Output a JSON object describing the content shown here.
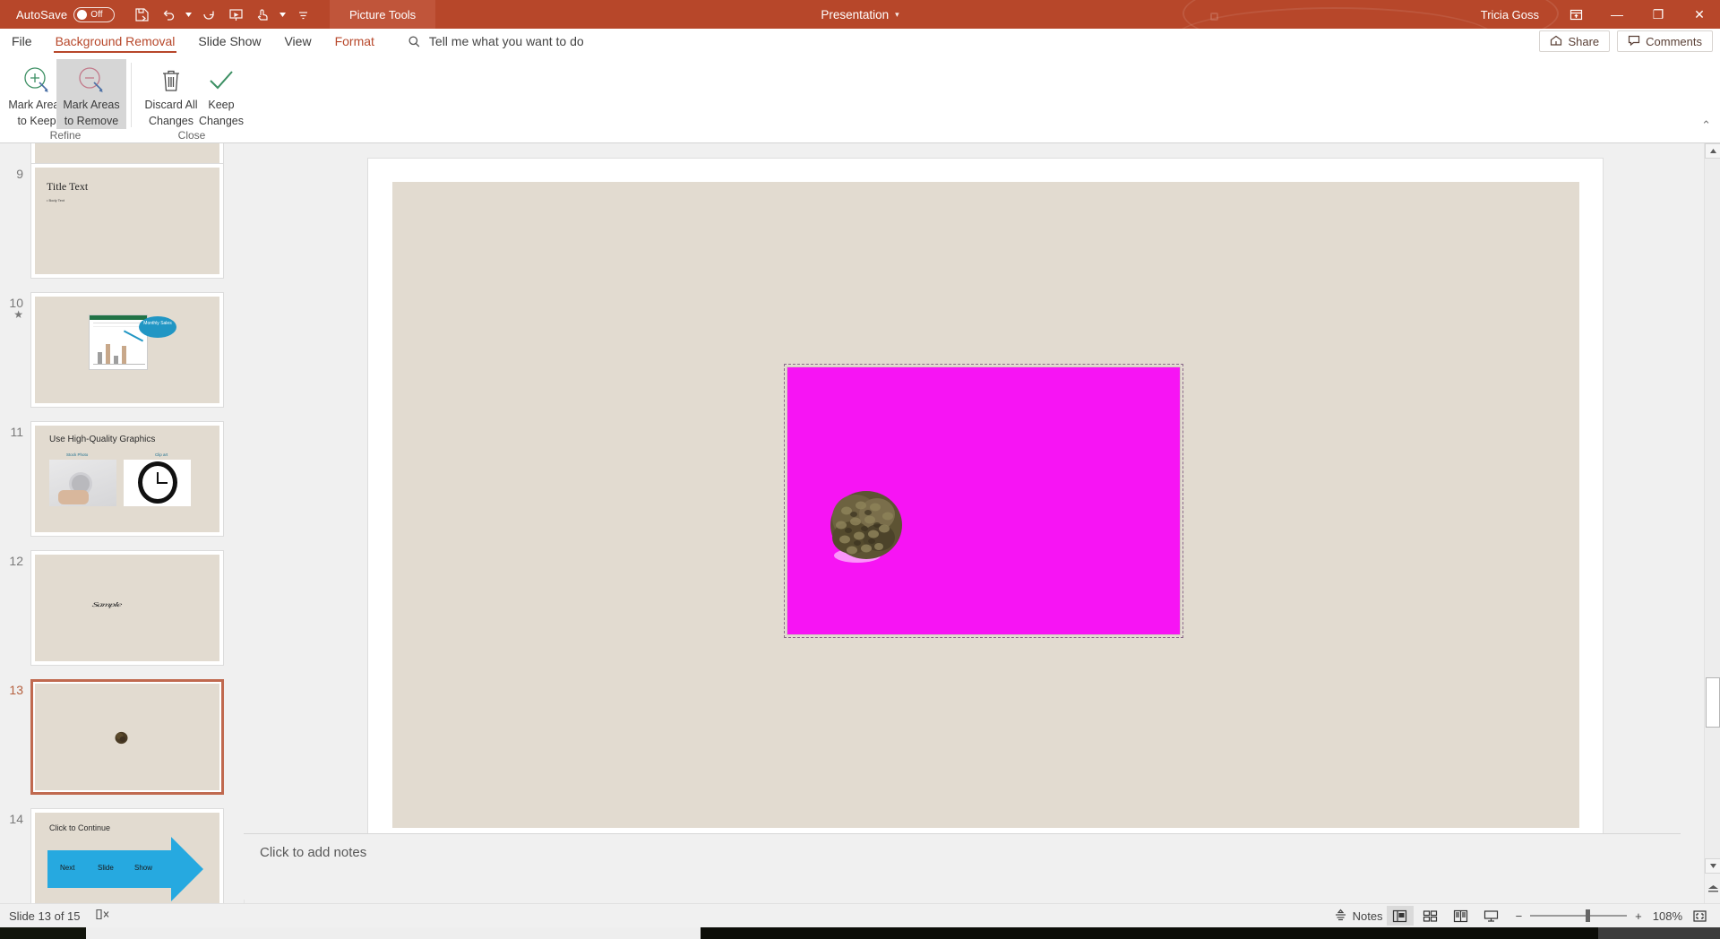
{
  "titlebar": {
    "autosave_label": "AutoSave",
    "autosave_state": "Off",
    "qat": [
      "save-icon",
      "undo-icon",
      "redo-icon",
      "start-presentation-icon",
      "touch-mode-icon",
      "customize-qat-icon"
    ],
    "context_tab": "Picture Tools",
    "document_title": "Presentation",
    "title_caret": "▾",
    "user_name": "Tricia Goss",
    "ribbon_display_icon": "ribbon-display-options-icon",
    "minimize": "—",
    "restore": "❐",
    "close": "✕",
    "accent_color": "#b7472a",
    "context_tab_color": "#c0553a"
  },
  "ribbon": {
    "tabs": [
      {
        "label": "File",
        "active": false
      },
      {
        "label": "Background Removal",
        "active": true
      },
      {
        "label": "Slide Show",
        "active": false
      },
      {
        "label": "View",
        "active": false
      },
      {
        "label": "Format",
        "active": false,
        "contextual": true
      }
    ],
    "tell_me": "Tell me what you want to do",
    "share_label": "Share",
    "comments_label": "Comments",
    "collapse_caret": "⌃",
    "groups": [
      {
        "name": "Refine",
        "buttons": [
          {
            "label_line1": "Mark Areas",
            "label_line2": "to Keep",
            "icon": "mark-areas-to-keep-icon",
            "selected": false
          },
          {
            "label_line1": "Mark Areas",
            "label_line2": "to Remove",
            "icon": "mark-areas-to-remove-icon",
            "selected": true
          }
        ]
      },
      {
        "name": "Close",
        "buttons": [
          {
            "label_line1": "Discard All",
            "label_line2": "Changes",
            "icon": "discard-all-changes-icon",
            "selected": false
          },
          {
            "label_line1": "Keep",
            "label_line2": "Changes",
            "icon": "keep-changes-icon",
            "selected": false
          }
        ]
      }
    ]
  },
  "thumbnails": [
    {
      "number": "9",
      "starred": false,
      "selected": false,
      "title": "Title Text",
      "body": "• Body Text",
      "kind": "title-body"
    },
    {
      "number": "10",
      "starred": true,
      "star_glyph": "★",
      "selected": false,
      "kind": "chart-callout",
      "callout": "Monthly Sales"
    },
    {
      "number": "11",
      "starred": false,
      "selected": false,
      "kind": "two-images",
      "title": "Use High-Quality Graphics",
      "caption_left": "Stock Photo",
      "caption_right": "Clip art"
    },
    {
      "number": "12",
      "starred": false,
      "selected": false,
      "kind": "wordart",
      "wordart": "Sample"
    },
    {
      "number": "13",
      "starred": false,
      "selected": true,
      "kind": "pinecone"
    },
    {
      "number": "14",
      "starred": false,
      "selected": false,
      "kind": "arrow-banner",
      "title": "Click to Continue",
      "arrow_words": [
        "Next",
        "Slide",
        "Show"
      ]
    }
  ],
  "slide": {
    "background_color": "#e2dbd0",
    "removal_overlay_color": "#f714f4",
    "picture_name": "pinecone-image",
    "selection_state": "selected"
  },
  "notes": {
    "placeholder": "Click to add notes"
  },
  "statusbar": {
    "slide_counter": "Slide 13 of 15",
    "accessibility_icon": "accessibility-checker-icon",
    "notes_label": "Notes",
    "views": [
      {
        "name": "normal-view",
        "active": true
      },
      {
        "name": "slide-sorter-view",
        "active": false
      },
      {
        "name": "reading-view",
        "active": false
      },
      {
        "name": "slide-show-view",
        "active": false
      }
    ],
    "zoom_out": "−",
    "zoom_in": "+",
    "zoom_level": "108%",
    "fit_slide_icon": "fit-slide-to-window-icon"
  }
}
